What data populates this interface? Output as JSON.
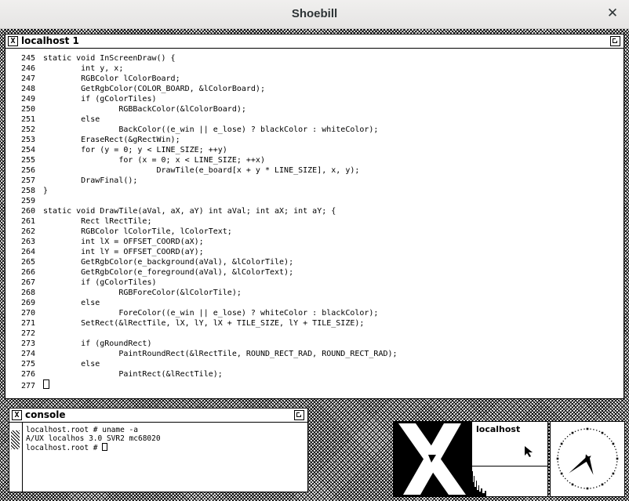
{
  "window": {
    "title": "Shoebill"
  },
  "main_window": {
    "title": "localhost 1",
    "lines": [
      {
        "n": "245",
        "t": "static void InScreenDraw() {"
      },
      {
        "n": "246",
        "t": "        int y, x;"
      },
      {
        "n": "247",
        "t": "        RGBColor lColorBoard;"
      },
      {
        "n": "248",
        "t": "        GetRgbColor(COLOR_BOARD, &lColorBoard);"
      },
      {
        "n": "249",
        "t": "        if (gColorTiles)"
      },
      {
        "n": "250",
        "t": "                RGBBackColor(&lColorBoard);"
      },
      {
        "n": "251",
        "t": "        else"
      },
      {
        "n": "252",
        "t": "                BackColor((e_win || e_lose) ? blackColor : whiteColor);"
      },
      {
        "n": "253",
        "t": "        EraseRect(&gRectWin);"
      },
      {
        "n": "254",
        "t": "        for (y = 0; y < LINE_SIZE; ++y)"
      },
      {
        "n": "255",
        "t": "                for (x = 0; x < LINE_SIZE; ++x)"
      },
      {
        "n": "256",
        "t": "                        DrawTile(e_board[x + y * LINE_SIZE], x, y);"
      },
      {
        "n": "257",
        "t": "        DrawFinal();"
      },
      {
        "n": "258",
        "t": "}"
      },
      {
        "n": "259",
        "t": ""
      },
      {
        "n": "260",
        "t": "static void DrawTile(aVal, aX, aY) int aVal; int aX; int aY; {"
      },
      {
        "n": "261",
        "t": "        Rect lRectTile;"
      },
      {
        "n": "262",
        "t": "        RGBColor lColorTile, lColorText;"
      },
      {
        "n": "263",
        "t": "        int lX = OFFSET_COORD(aX);"
      },
      {
        "n": "264",
        "t": "        int lY = OFFSET_COORD(aY);"
      },
      {
        "n": "265",
        "t": "        GetRgbColor(e_background(aVal), &lColorTile);"
      },
      {
        "n": "266",
        "t": "        GetRgbColor(e_foreground(aVal), &lColorText);"
      },
      {
        "n": "267",
        "t": "        if (gColorTiles)"
      },
      {
        "n": "268",
        "t": "                RGBForeColor(&lColorTile);"
      },
      {
        "n": "269",
        "t": "        else"
      },
      {
        "n": "270",
        "t": "                ForeColor((e_win || e_lose) ? whiteColor : blackColor);"
      },
      {
        "n": "271",
        "t": "        SetRect(&lRectTile, lX, lY, lX + TILE_SIZE, lY + TILE_SIZE);"
      },
      {
        "n": "272",
        "t": ""
      },
      {
        "n": "273",
        "t": "        if (gRoundRect)"
      },
      {
        "n": "274",
        "t": "                PaintRoundRect(&lRectTile, ROUND_RECT_RAD, ROUND_RECT_RAD);"
      },
      {
        "n": "275",
        "t": "        else"
      },
      {
        "n": "276",
        "t": "                PaintRect(&lRectTile);"
      },
      {
        "n": "277",
        "t": ""
      }
    ]
  },
  "console_window": {
    "title": "console",
    "lines": [
      "localhost.root # uname -a",
      "A/UX localhos 3.0 SVR2 mc68020",
      "localhost.root # "
    ]
  },
  "xload": {
    "host": "localhost"
  },
  "icons": {
    "close": "close-icon",
    "x_window": "x-window-icon",
    "resize": "resize-icon",
    "xlogo": "x-logo-icon",
    "clock": "clock-icon",
    "pointer": "mouse-pointer-icon"
  },
  "colors": {
    "titlebar": "#e8e7e6",
    "desktop_pattern": "#000000",
    "window_bg": "#ffffff"
  }
}
